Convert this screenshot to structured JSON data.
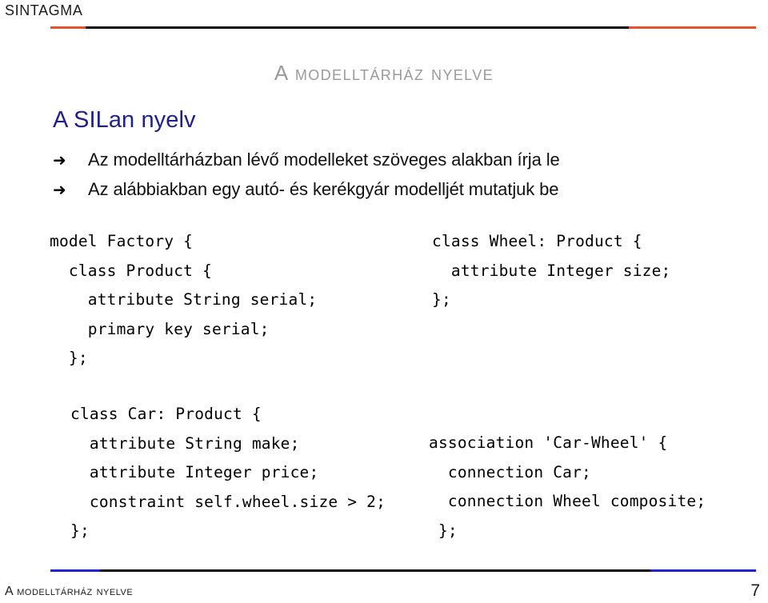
{
  "slide": {
    "brand": "SINTAGMA",
    "title": "A modelltárház nyelve",
    "subtitle": "A SILan nyelv",
    "page_number": "7",
    "footer": "A modelltárház nyelve"
  },
  "rules": {
    "top": {
      "accent_color": "#e8512a",
      "line_color": "#0a0a0a",
      "segments": [
        {
          "color": "#e8512a",
          "width_pct": 5
        },
        {
          "color": "#0a0a0a",
          "width_pct": 77
        },
        {
          "color": "#e8512a",
          "width_pct": 18
        }
      ]
    },
    "bottom": {
      "accent_color": "#2020d8",
      "line_color": "#0a0a0a",
      "segments": [
        {
          "color": "#2020d8",
          "width_pct": 7
        },
        {
          "color": "#0a0a0a",
          "width_pct": 78
        },
        {
          "color": "#2020d8",
          "width_pct": 15
        }
      ]
    }
  },
  "bullets": {
    "icon": "arrow-right-icon",
    "icon_glyph": "➜",
    "items": [
      "Az modelltárházban lévő modelleket szöveges alakban írja le",
      "Az alábbiakban egy autó- és kerékgyár modelljét mutatjuk be"
    ]
  },
  "code": {
    "block_a_left": "model Factory {\n  class Product {\n    attribute String serial;\n    primary key serial;\n  };",
    "block_a_right": "class Wheel: Product {\n  attribute Integer size;\n};",
    "block_b_left": "class Car: Product {\n  attribute String make;\n  attribute Integer price;\n  constraint self.wheel.size > 2;\n};",
    "block_b_right": "association 'Car-Wheel' {\n  connection Car;\n  connection Wheel composite;\n };"
  },
  "colors": {
    "title_gray": "#9a9a9a",
    "subtitle_blue": "#1f1f8e",
    "accent_orange": "#e8512a",
    "accent_blue": "#2020d8",
    "text_black": "#111111"
  }
}
